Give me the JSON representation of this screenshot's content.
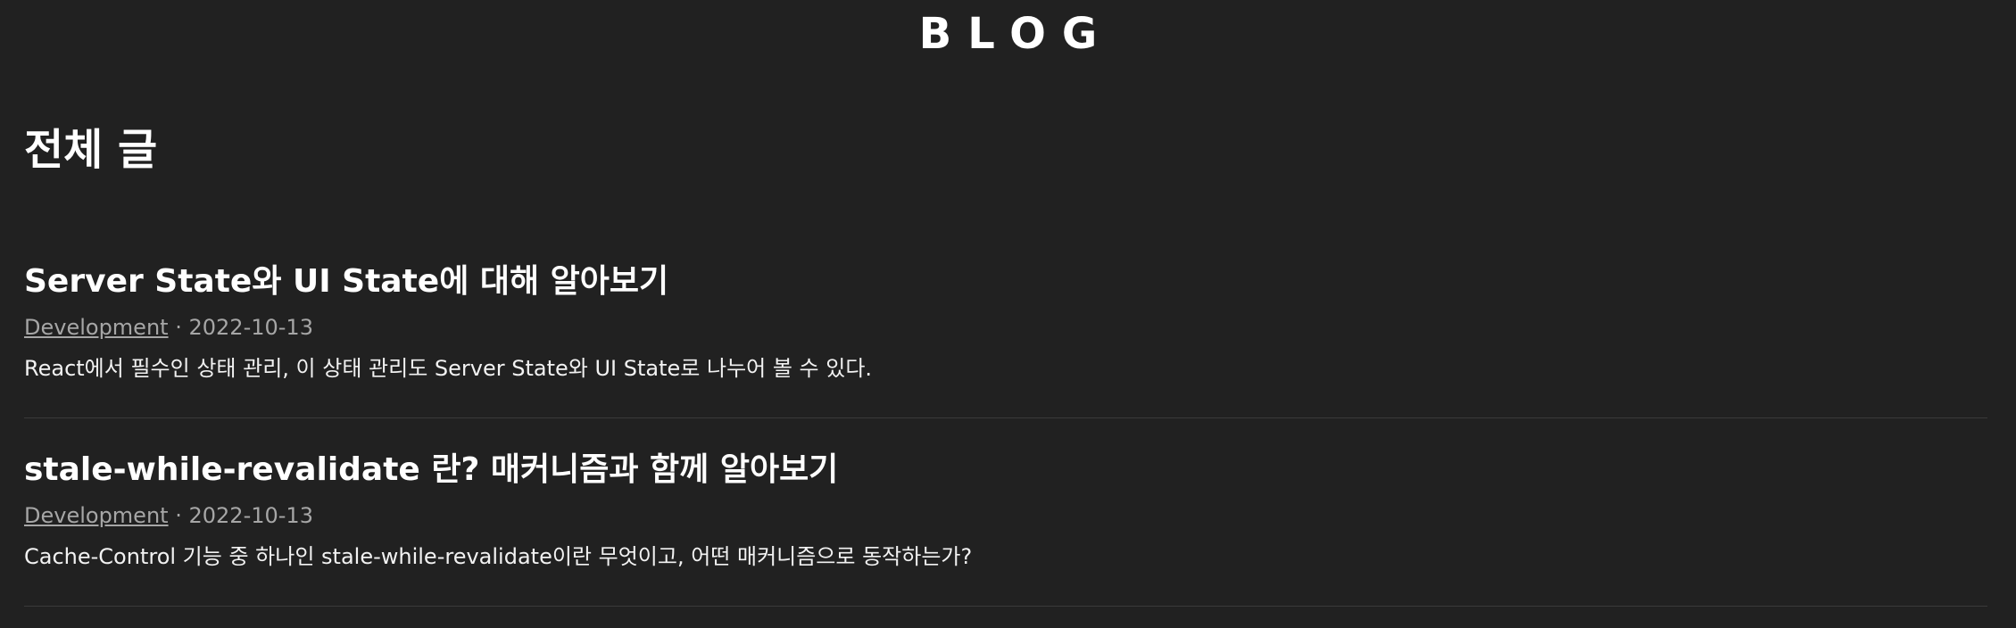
{
  "header": {
    "logo": "BLOG"
  },
  "main": {
    "title": "전체 글",
    "posts": [
      {
        "title": "Server State와 UI State에 대해 알아보기",
        "category": "Development",
        "separator": "·",
        "date": "2022-10-13",
        "description": "React에서 필수인 상태 관리, 이 상태 관리도 Server State와 UI State로 나누어 볼 수 있다."
      },
      {
        "title": "stale-while-revalidate 란? 매커니즘과 함께 알아보기",
        "category": "Development",
        "separator": "·",
        "date": "2022-10-13",
        "description": "Cache-Control 기능 중 하나인 stale-while-revalidate이란 무엇이고, 어떤 매커니즘으로 동작하는가?"
      }
    ]
  },
  "colors": {
    "background": "#212121",
    "text": "#ffffff",
    "meta": "#a6a6a6",
    "divider": "#3a3a3a"
  }
}
